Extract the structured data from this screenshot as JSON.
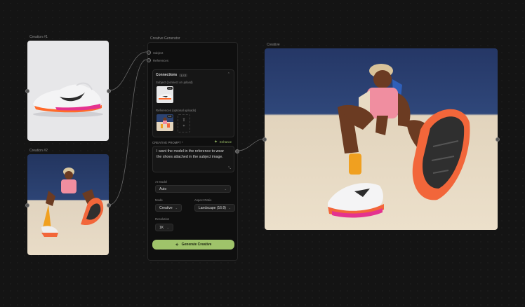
{
  "nodes": {
    "creation1": {
      "label": "Creation #1"
    },
    "creation2": {
      "label": "Creation #2"
    },
    "generator": {
      "label": "Creative Generator"
    },
    "creative": {
      "label": "Creative"
    }
  },
  "generator": {
    "inputs": {
      "subject": "Subject",
      "references": "References"
    },
    "connections": {
      "title": "Connections",
      "count": "1 / 2",
      "subject_label": "Subject (connect or upload)",
      "subject_badge": "1/3",
      "references_label": "References (optional uploads)",
      "references_badge": "1/3"
    },
    "prompt": {
      "label": "CREATIVE PROMPT *",
      "enhance": "Enhance",
      "text": "I want the model in the reference to wear the shoes attached in the subject image."
    },
    "ai_model": {
      "label": "AI Model",
      "value": "Auto"
    },
    "mode": {
      "label": "Mode",
      "value": "Creative"
    },
    "aspect_ratio": {
      "label": "Aspect Ratio",
      "value": "Landscape (16:9)"
    },
    "resolution": {
      "label": "Resolution",
      "value": "1K"
    },
    "generate_label": "Generate Creative"
  },
  "colors": {
    "canvas": "#141414",
    "panel": "#0f0f0f",
    "accent_green": "#9fc36a",
    "sky_blue": "#2d4475",
    "wall_sand": "#e6d9c4",
    "shoe_orange": "#f2663a"
  }
}
